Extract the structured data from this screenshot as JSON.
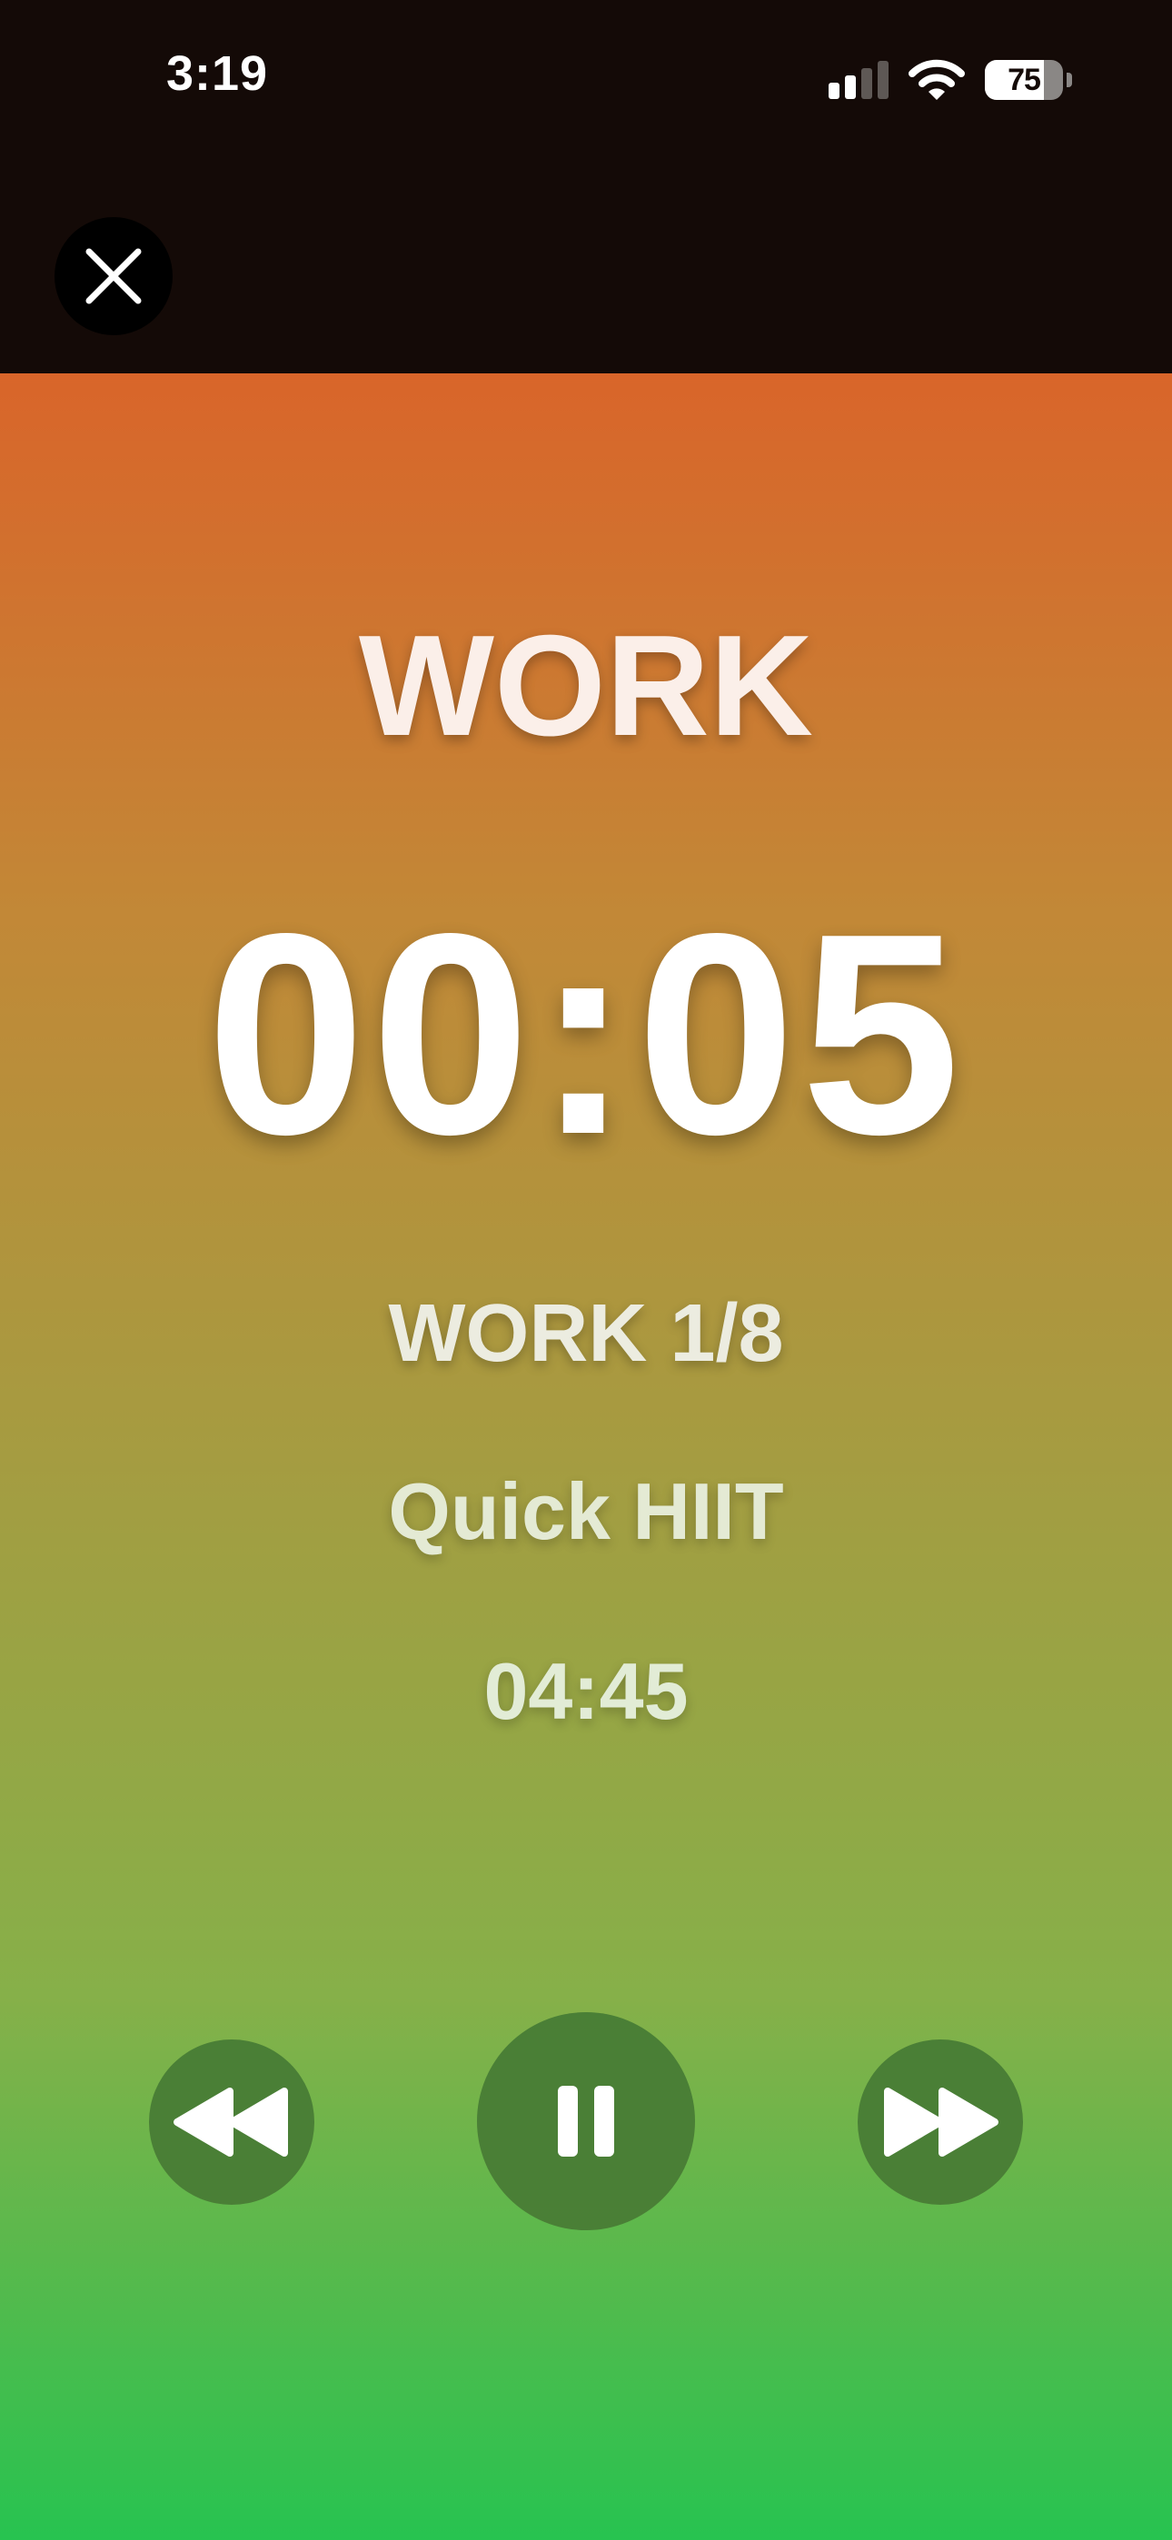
{
  "status_bar": {
    "time": "3:19",
    "battery_percent": "75",
    "battery_level": 0.75,
    "icons": [
      "cellular-signal-icon",
      "wifi-icon",
      "battery-icon"
    ]
  },
  "header": {
    "close_icon": "close-icon"
  },
  "timer": {
    "phase": "WORK",
    "countdown": "00:05",
    "round": "WORK 1/8",
    "workout_name": "Quick HIIT",
    "total_remaining": "04:45"
  },
  "controls": {
    "previous_icon": "backward-icon",
    "pause_icon": "pause-icon",
    "next_icon": "forward-icon"
  },
  "colors": {
    "top_background": "#140a07",
    "gradient_top": "#d9652a",
    "gradient_bottom": "#27c350",
    "control_button": "#4a7f36"
  }
}
